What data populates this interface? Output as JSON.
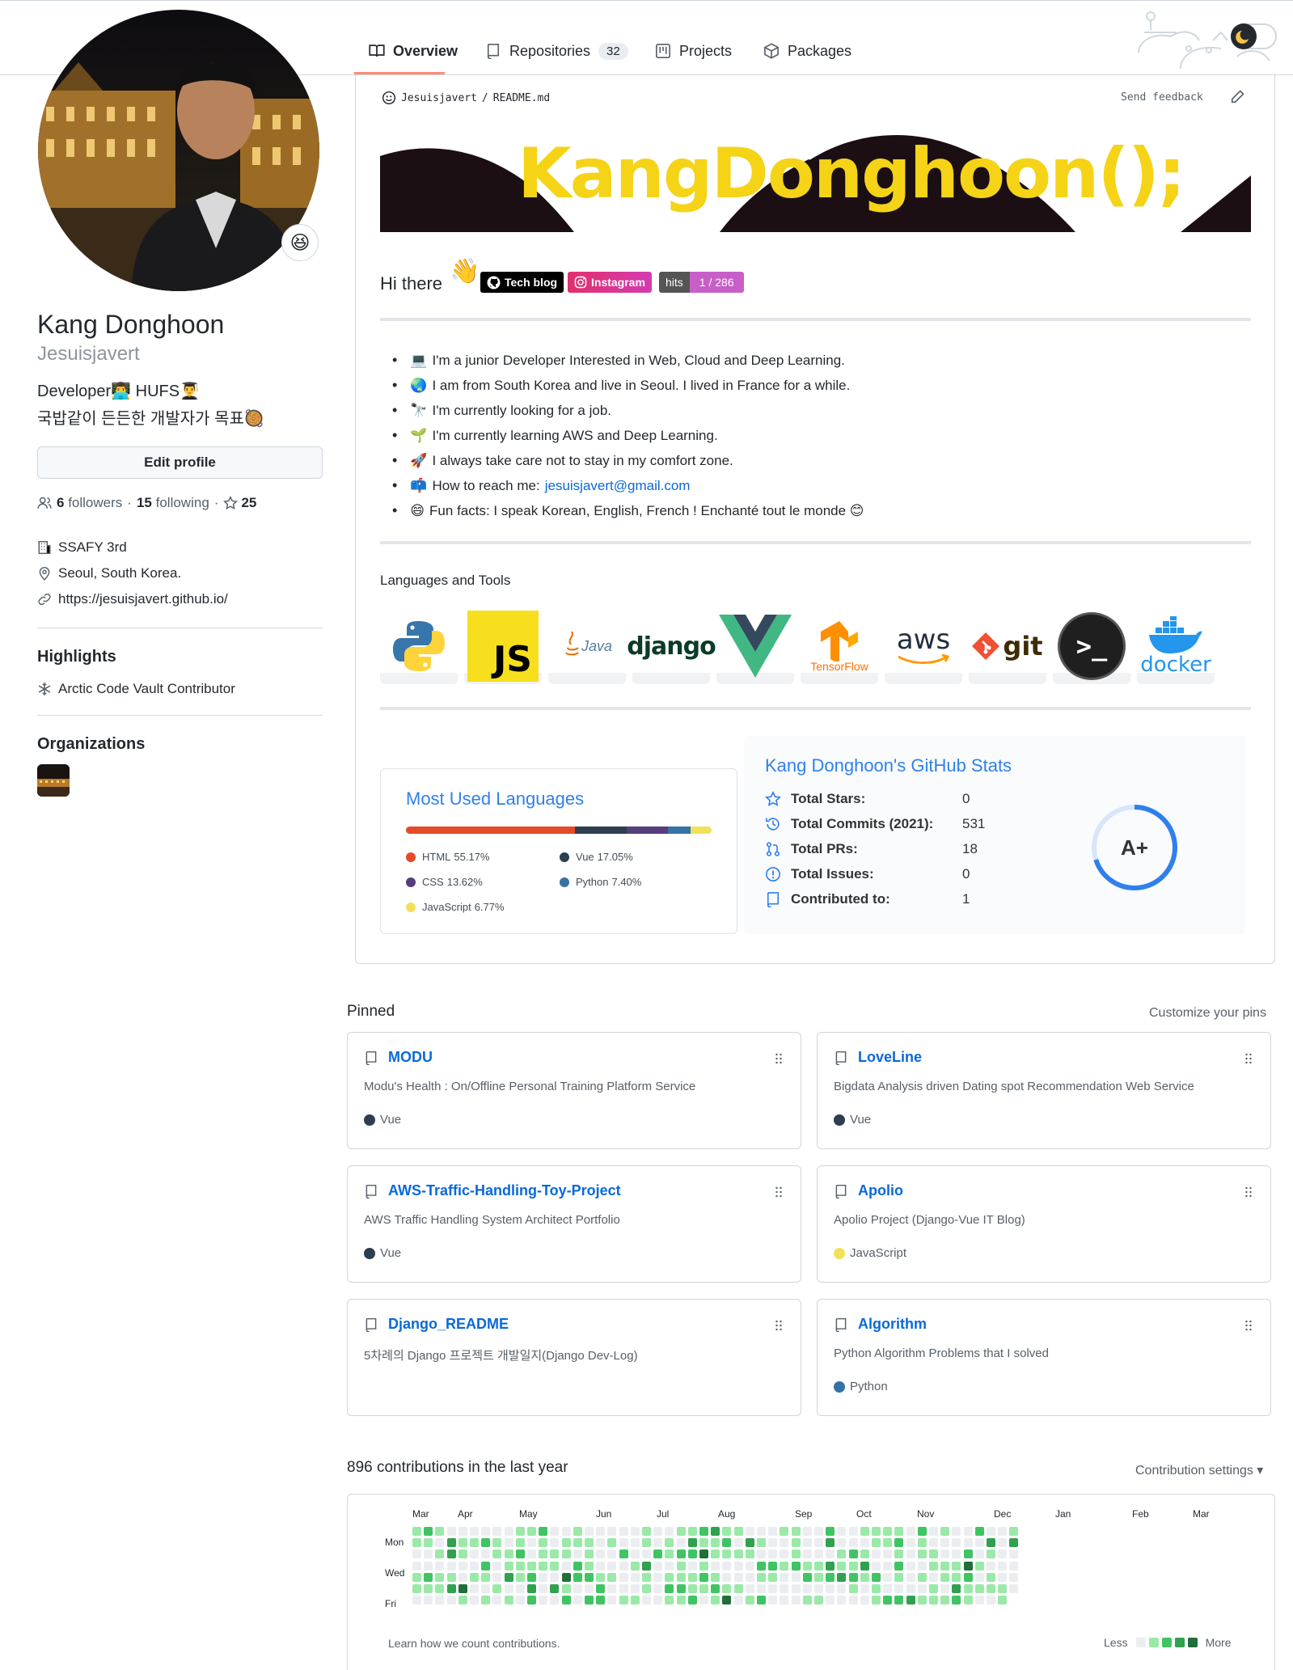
{
  "nav": {
    "tabs": [
      {
        "label": "Overview"
      },
      {
        "label": "Repositories",
        "count": "32"
      },
      {
        "label": "Projects"
      },
      {
        "label": "Packages"
      }
    ]
  },
  "profile": {
    "full_name": "Kang Donghoon",
    "username": "Jesuisjavert",
    "bio_line1": "Developer👨‍💻 HUFS👨‍🎓",
    "bio_line2": "국밥같이 든든한 개발자가 목표🥘",
    "status_emoji": "😆",
    "edit_button": "Edit profile",
    "followers_count": "6",
    "followers_label": "followers",
    "following_count": "15",
    "following_label": "following",
    "stars_count": "25",
    "company": "SSAFY 3rd",
    "location": "Seoul, South Korea.",
    "website": "https://jesuisjavert.github.io/",
    "highlights_heading": "Highlights",
    "highlight_item": "Arctic Code Vault Contributor",
    "organizations_heading": "Organizations"
  },
  "readme": {
    "owner": "Jesuisjavert",
    "sep": "/",
    "file": "README.md",
    "send_feedback": "Send feedback",
    "banner_text": "KangDonghoon();",
    "greeting": "Hi there",
    "greeting_emoji": "👋",
    "badges": {
      "tech_blog": "Tech blog",
      "instagram": "Instagram",
      "hits_label": "hits",
      "hits_value": "1 / 286"
    },
    "bullets": [
      {
        "emoji": "💻",
        "text": "I'm a junior Developer Interested in Web, Cloud and Deep Learning."
      },
      {
        "emoji": "🌏",
        "text": "I am from South Korea and live in Seoul. I lived in France for a while."
      },
      {
        "emoji": "🔭",
        "text": "I'm currently looking for a job."
      },
      {
        "emoji": "🌱",
        "text": "I'm currently learning AWS and Deep Learning."
      },
      {
        "emoji": "🚀",
        "text": "I always take care not to stay in my comfort zone."
      },
      {
        "emoji": "📫",
        "text": "How to reach me: ",
        "link": "jesuisjavert@gmail.com"
      },
      {
        "emoji": "😄",
        "text": "Fun facts: I speak Korean, English, French ! Enchanté tout le monde 😊"
      }
    ],
    "tools_heading": "Languages and Tools",
    "tools": {
      "js": "JS",
      "java": "Java",
      "django": "django",
      "tensorflow": "TensorFlow",
      "aws": "aws",
      "git": "git",
      "terminal": ">_",
      "docker": "docker"
    }
  },
  "languages_card": {
    "title": "Most Used Languages",
    "items": [
      {
        "name": "HTML",
        "percent": "55.17%",
        "color": "#e34c26"
      },
      {
        "name": "Vue",
        "percent": "17.05%",
        "color": "#2c3e50"
      },
      {
        "name": "CSS",
        "percent": "13.62%",
        "color": "#563d7c"
      },
      {
        "name": "Python",
        "percent": "7.40%",
        "color": "#3572A5"
      },
      {
        "name": "JavaScript",
        "percent": "6.77%",
        "color": "#f1e05a"
      }
    ]
  },
  "stats_card": {
    "title": "Kang Donghoon's GitHub Stats",
    "rows": [
      {
        "label": "Total Stars:",
        "value": "0"
      },
      {
        "label": "Total Commits (2021):",
        "value": "531"
      },
      {
        "label": "Total PRs:",
        "value": "18"
      },
      {
        "label": "Total Issues:",
        "value": "0"
      },
      {
        "label": "Contributed to:",
        "value": "1"
      }
    ],
    "grade": "A+",
    "accent": "#2f80ed"
  },
  "pinned": {
    "heading": "Pinned",
    "customize": "Customize your pins",
    "repos": [
      {
        "name": "MODU",
        "desc": "Modu's Health : On/Offline Personal Training Platform Service",
        "lang": "Vue",
        "color": "#2c3e50"
      },
      {
        "name": "LoveLine",
        "desc": "Bigdata Analysis driven Dating spot Recommendation Web Service",
        "lang": "Vue",
        "color": "#2c3e50"
      },
      {
        "name": "AWS-Traffic-Handling-Toy-Project",
        "desc": "AWS Traffic Handling System Architect Portfolio",
        "lang": "Vue",
        "color": "#2c3e50"
      },
      {
        "name": "Apolio",
        "desc": "Apolio Project (Django-Vue IT Blog)",
        "lang": "JavaScript",
        "color": "#f1e05a"
      },
      {
        "name": "Django_README",
        "desc": "5차례의 Django 프로젝트 개발일지(Django Dev-Log)",
        "lang": "",
        "color": ""
      },
      {
        "name": "Algorithm",
        "desc": "Python Algorithm Problems that I solved",
        "lang": "Python",
        "color": "#3572A5"
      }
    ]
  },
  "contributions": {
    "heading": "896 contributions in the last year",
    "settings": "Contribution settings ▾",
    "months": [
      "Mar",
      "Apr",
      "May",
      "Jun",
      "Jul",
      "Aug",
      "Sep",
      "Oct",
      "Nov",
      "Dec",
      "Jan",
      "Feb",
      "Mar"
    ],
    "day_labels": [
      "Mon",
      "Wed",
      "Fri"
    ],
    "footer": "Learn how we count contributions.",
    "less": "Less",
    "more": "More",
    "colors": [
      "#ebedf0",
      "#9be9a8",
      "#40c463",
      "#30a14e",
      "#216e39"
    ]
  }
}
